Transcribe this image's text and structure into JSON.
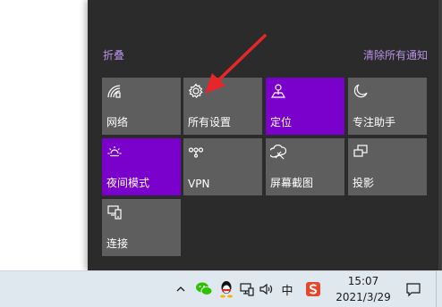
{
  "action_center": {
    "collapse_label": "折叠",
    "clear_all_label": "清除所有通知",
    "accent_color": "#7a00cc",
    "tiles": [
      {
        "label": "网络",
        "icon": "network-icon",
        "active": false
      },
      {
        "label": "所有设置",
        "icon": "gear-icon",
        "active": false
      },
      {
        "label": "定位",
        "icon": "location-icon",
        "active": true
      },
      {
        "label": "专注助手",
        "icon": "moon-icon",
        "active": false
      },
      {
        "label": "夜间模式",
        "icon": "sun-icon",
        "active": true
      },
      {
        "label": "VPN",
        "icon": "vpn-icon",
        "active": false
      },
      {
        "label": "屏幕截图",
        "icon": "screenshot-icon",
        "active": false
      },
      {
        "label": "投影",
        "icon": "project-icon",
        "active": false
      },
      {
        "label": "连接",
        "icon": "connect-icon",
        "active": false
      }
    ]
  },
  "taskbar": {
    "ime_label": "中",
    "time": "15:07",
    "date": "2021/3/29",
    "tray_icons": [
      "chevron-up-icon",
      "wechat-icon",
      "qq-icon",
      "network-icon",
      "volume-icon",
      "ime-label",
      "sogou-icon",
      "notification-icon"
    ]
  }
}
